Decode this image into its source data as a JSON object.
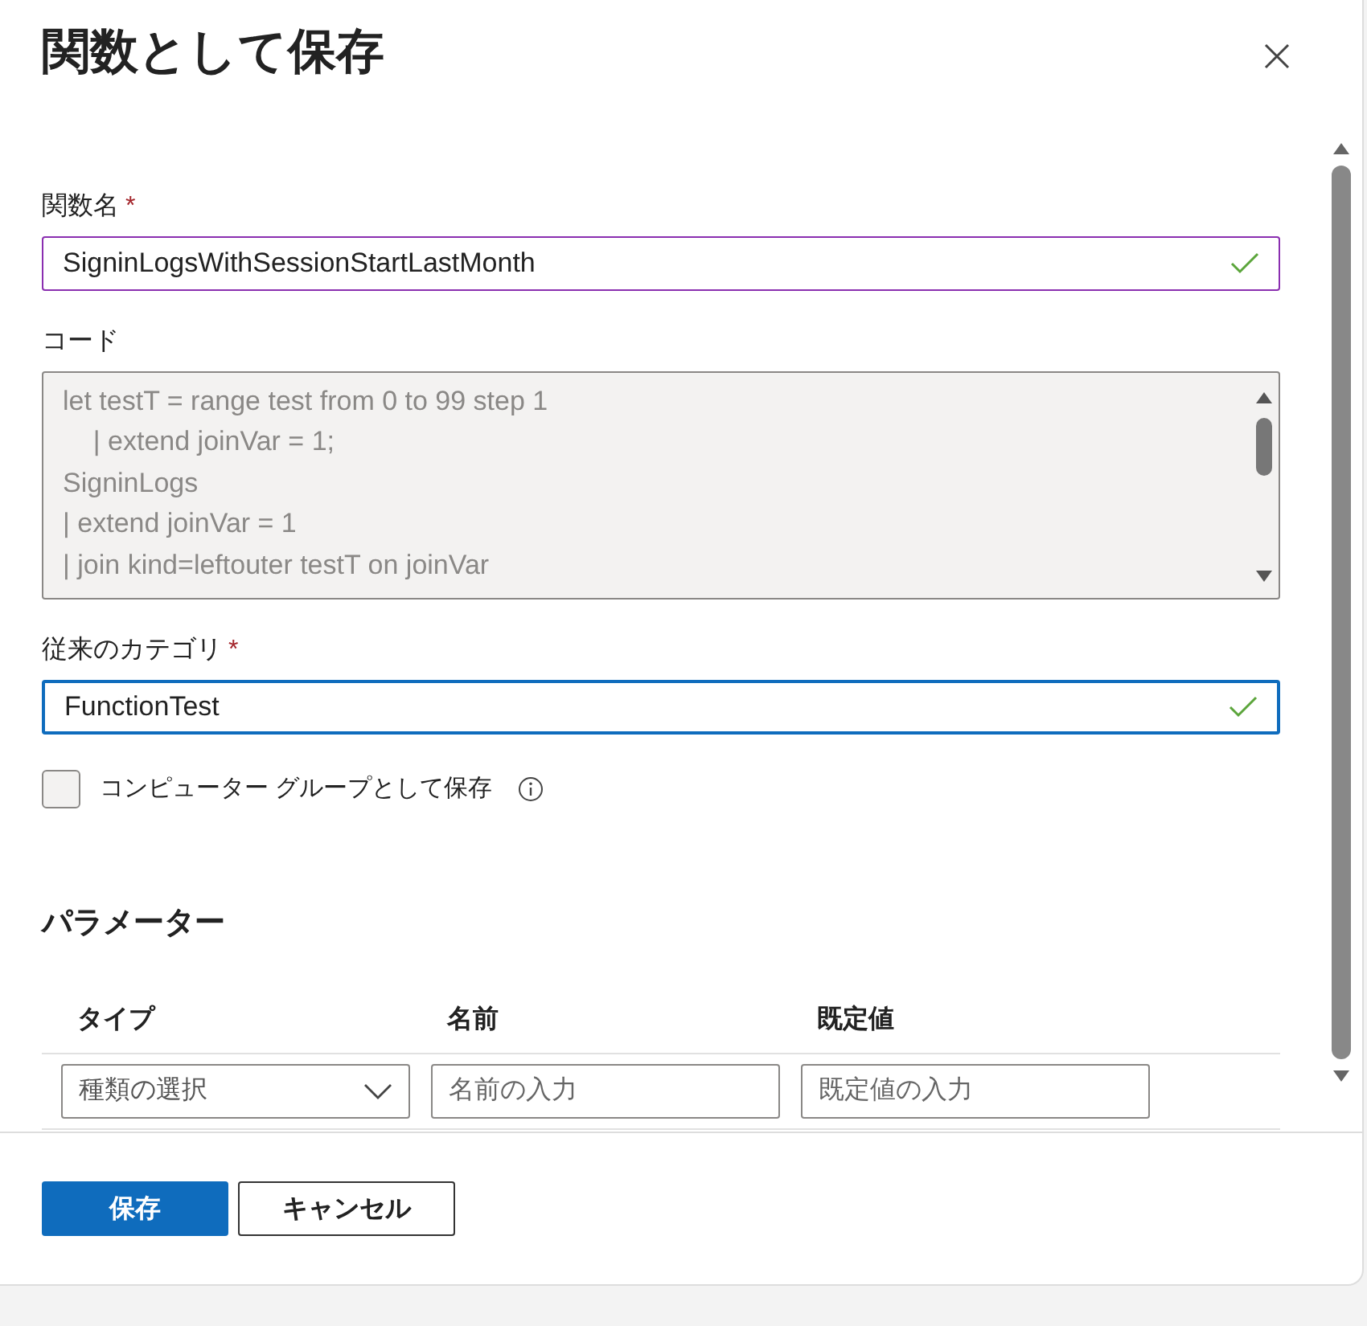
{
  "title": "関数として保存",
  "name_field": {
    "label": "関数名",
    "required_mark": "*",
    "value": "SigninLogsWithSessionStartLastMonth",
    "valid": true,
    "focused": false
  },
  "code": {
    "label": "コード",
    "disabled": true,
    "lines": [
      "let testT = range test from 0 to 99 step 1",
      "    | extend joinVar = 1;",
      "SigninLogs",
      "| extend joinVar = 1",
      "| join kind=leftouter testT on joinVar"
    ]
  },
  "category_field": {
    "label": "従来のカテゴリ",
    "required_mark": "*",
    "value": "FunctionTest",
    "valid": true,
    "focused": true
  },
  "computer_group": {
    "label": "コンピューター グループとして保存",
    "checked": false
  },
  "parameters": {
    "heading": "パラメーター",
    "columns": [
      "タイプ",
      "名前",
      "既定値"
    ],
    "row": {
      "type_placeholder": "種類の選択",
      "name_placeholder": "名前の入力",
      "default_placeholder": "既定値の入力"
    }
  },
  "buttons": [
    {
      "label": "保存",
      "kind": "primary"
    },
    {
      "label": "キャンセル",
      "kind": "secondary"
    }
  ]
}
